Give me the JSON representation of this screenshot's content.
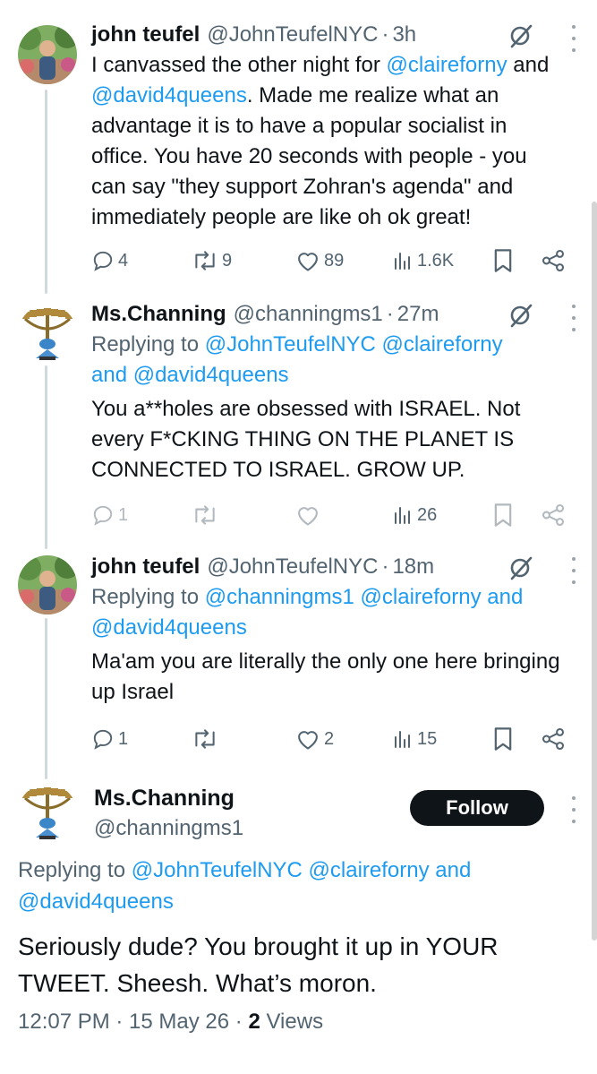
{
  "tweets": [
    {
      "name": "john teufel",
      "handle": "@JohnTeufelNYC",
      "time": "3h",
      "body_parts": [
        "I canvassed the other night for ",
        "@claireforny",
        " and ",
        "@david4queens",
        ". Made me realize what an advantage it is to have a popular socialist in office. You have 20 seconds with people - you can say \"they support Zohran's agenda\" and immediately people are like oh ok great!"
      ],
      "replies": "4",
      "reposts": "9",
      "likes": "89",
      "views": "1.6K"
    },
    {
      "name": "Ms.Channing",
      "handle": "@channingms1",
      "time": "27m",
      "replying_label": "Replying to ",
      "reply_handle_1": "@JohnTeufelNYC",
      "reply_handle_2": "@claireforny",
      "reply_and": "and",
      "reply_handle_3": "@david4queens",
      "body": "You a**holes are obsessed with ISRAEL. Not every F*CKING THING ON THE PLANET IS CONNECTED TO ISRAEL. GROW UP.",
      "replies": "1",
      "views": "26"
    },
    {
      "name": "john teufel",
      "handle": "@JohnTeufelNYC",
      "time": "18m",
      "replying_label": "Replying to ",
      "reply_handle_1": "@channingms1",
      "reply_handle_2": "@claireforny",
      "reply_and": "and",
      "reply_handle_3": "@david4queens",
      "body": "Ma'am you are literally the only one here bringing up Israel",
      "replies": "1",
      "likes": "2",
      "views": "15"
    }
  ],
  "focused": {
    "name": "Ms.Channing",
    "handle": "@channingms1",
    "follow_label": "Follow",
    "replying_label": "Replying to ",
    "reply_handle_1": "@JohnTeufelNYC",
    "reply_handle_2": "@claireforny",
    "reply_and": "and",
    "reply_handle_3": "@david4queens",
    "body": "Seriously dude? You brought it up in YOUR TWEET. Sheesh. What’s moron.",
    "timestamp": "12:07 PM · 15 May 26 · ",
    "views_count": "2",
    "views_label": " Views"
  },
  "colors": {
    "link": "#1d9bf0",
    "secondary": "#536471",
    "text": "#0f1419"
  },
  "dot": "·"
}
